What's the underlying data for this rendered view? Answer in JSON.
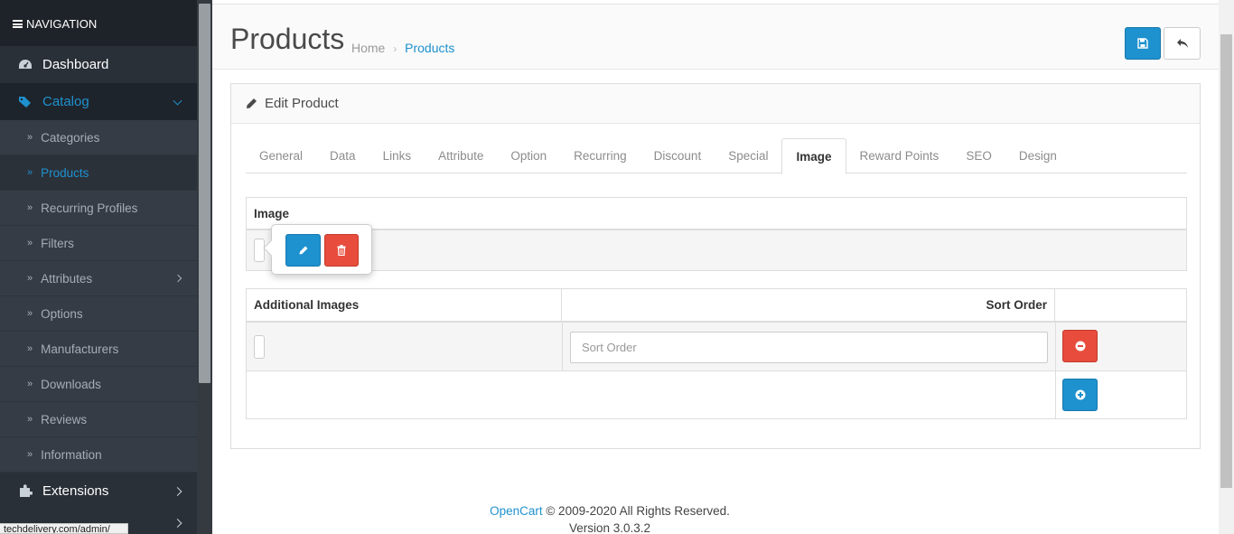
{
  "sidebar": {
    "nav_title": "NAVIGATION",
    "dashboard": "Dashboard",
    "catalog": "Catalog",
    "catalog_items": [
      {
        "label": "Categories"
      },
      {
        "label": "Products"
      },
      {
        "label": "Recurring Profiles"
      },
      {
        "label": "Filters"
      },
      {
        "label": "Attributes"
      },
      {
        "label": "Options"
      },
      {
        "label": "Manufacturers"
      },
      {
        "label": "Downloads"
      },
      {
        "label": "Reviews"
      },
      {
        "label": "Information"
      }
    ],
    "extensions": "Extensions",
    "status_url": "techdelivery.com/admin/"
  },
  "header": {
    "title": "Products",
    "breadcrumb_home": "Home",
    "breadcrumb_sep": "›",
    "breadcrumb_current": "Products"
  },
  "panel": {
    "title": "Edit Product",
    "tabs": [
      "General",
      "Data",
      "Links",
      "Attribute",
      "Option",
      "Recurring",
      "Discount",
      "Special",
      "Image",
      "Reward Points",
      "SEO",
      "Design"
    ],
    "active_tab": "Image",
    "image_header": "Image",
    "additional_header": "Additional Images",
    "sort_header": "Sort Order",
    "sort_placeholder": "Sort Order"
  },
  "footer": {
    "brand": "OpenCart",
    "copyright": " © 2009-2020 All Rights Reserved.",
    "version": "Version 3.0.3.2"
  },
  "colors": {
    "primary": "#1e91cf",
    "danger": "#e74c3c",
    "sidebar_bg": "#2a3038"
  }
}
